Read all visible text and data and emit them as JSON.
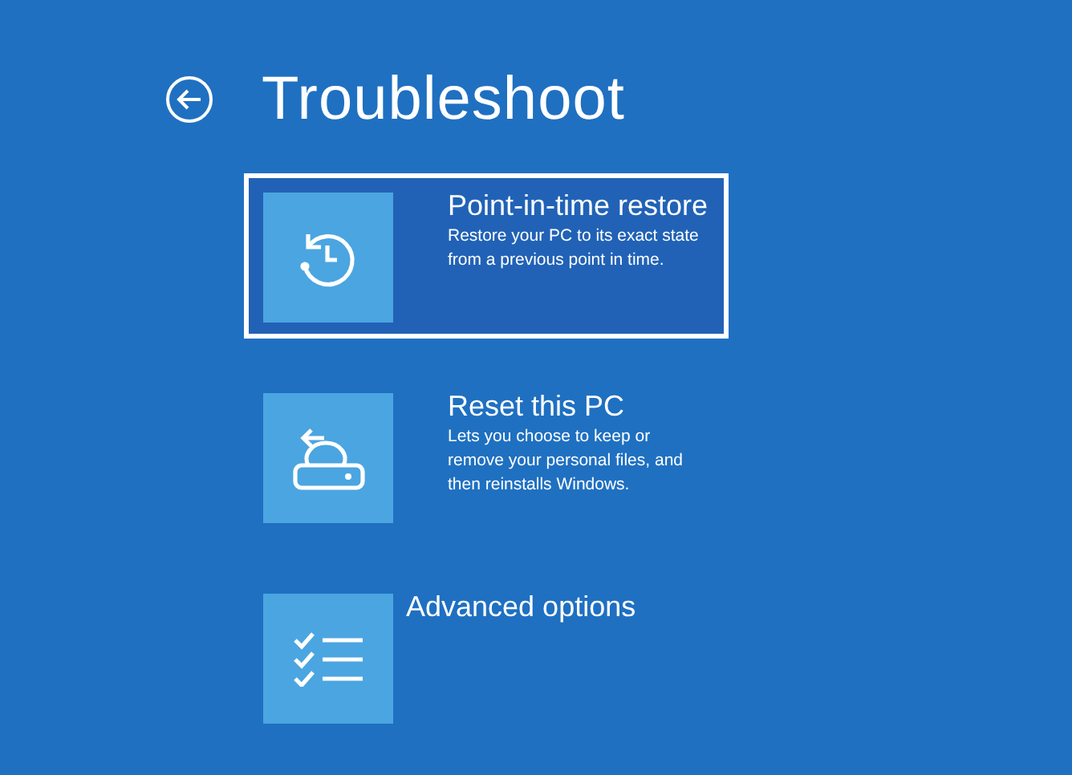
{
  "title": "Troubleshoot",
  "options": [
    {
      "kind": "restore",
      "label": "Point-in-time restore",
      "description": "Restore your PC to its exact state from a previous point in time.",
      "selected": true
    },
    {
      "kind": "reset",
      "label": "Reset this PC",
      "description": "Lets you choose to keep or remove your personal files, and then reinstalls Windows.",
      "selected": false
    },
    {
      "kind": "advanced",
      "label": "Advanced options",
      "selected": false
    }
  ]
}
